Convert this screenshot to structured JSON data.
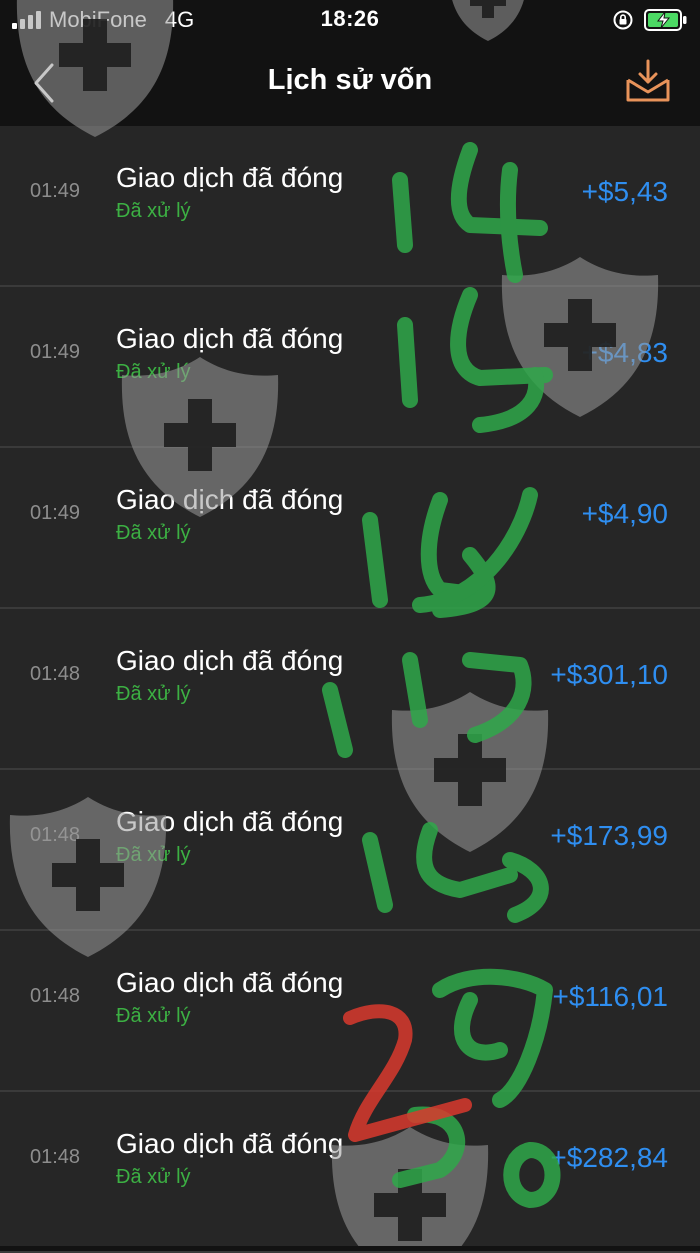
{
  "status_bar": {
    "carrier": "MobiFone",
    "network": "4G",
    "time": "18:26"
  },
  "header": {
    "title": "Lịch sử vốn",
    "back_icon": "chevron-left-icon",
    "download_icon": "inbox-download-icon"
  },
  "transactions": [
    {
      "time": "01:49",
      "title": "Giao dịch đã đóng",
      "status": "Đã xử lý",
      "amount": "+$5,43"
    },
    {
      "time": "01:49",
      "title": "Giao dịch đã đóng",
      "status": "Đã xử lý",
      "amount": "+$4,83"
    },
    {
      "time": "01:49",
      "title": "Giao dịch đã đóng",
      "status": "Đã xử lý",
      "amount": "+$4,90"
    },
    {
      "time": "01:48",
      "title": "Giao dịch đã đóng",
      "status": "Đã xử lý",
      "amount": "+$301,10"
    },
    {
      "time": "01:48",
      "title": "Giao dịch đã đóng",
      "status": "Đã xử lý",
      "amount": "+$173,99"
    },
    {
      "time": "01:48",
      "title": "Giao dịch đã đóng",
      "status": "Đã xử lý",
      "amount": "+$116,01"
    },
    {
      "time": "01:48",
      "title": "Giao dịch đã đóng",
      "status": "Đã xử lý",
      "amount": "+$282,84"
    }
  ],
  "colors": {
    "background": "#121212",
    "list_background": "#262626",
    "amount": "#2f8ef0",
    "status": "#3cb043",
    "accent_icon": "#e8935a",
    "handwriting": "#2fa84a",
    "handwriting_red": "#d93a2e",
    "watermark": "#8a8a8a"
  }
}
